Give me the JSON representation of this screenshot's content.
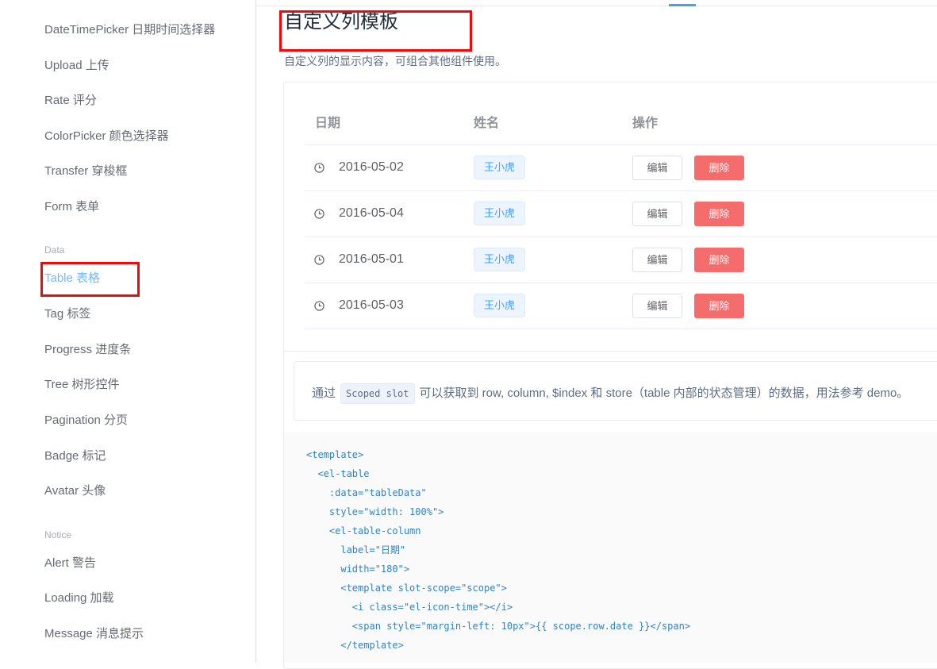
{
  "sidebar": {
    "items_top": [
      {
        "label": "DateTimePicker 日期时间选择器"
      },
      {
        "label": "Upload 上传"
      },
      {
        "label": "Rate 评分"
      },
      {
        "label": "ColorPicker 颜色选择器"
      },
      {
        "label": "Transfer 穿梭框"
      },
      {
        "label": "Form 表单"
      }
    ],
    "group_data": "Data",
    "items_data": [
      {
        "label": "Table 表格"
      },
      {
        "label": "Tag 标签"
      },
      {
        "label": "Progress 进度条"
      },
      {
        "label": "Tree 树形控件"
      },
      {
        "label": "Pagination 分页"
      },
      {
        "label": "Badge 标记"
      },
      {
        "label": "Avatar 头像"
      }
    ],
    "group_notice": "Notice",
    "items_notice": [
      {
        "label": "Alert 警告"
      },
      {
        "label": "Loading 加载"
      },
      {
        "label": "Message 消息提示"
      }
    ]
  },
  "main": {
    "title": "自定义列模板",
    "description": "自定义列的显示内容，可组合其他组件使用。",
    "table": {
      "headers": [
        "日期",
        "姓名",
        "操作"
      ],
      "rows": [
        {
          "date": "2016-05-02",
          "name": "王小虎"
        },
        {
          "date": "2016-05-04",
          "name": "王小虎"
        },
        {
          "date": "2016-05-01",
          "name": "王小虎"
        },
        {
          "date": "2016-05-03",
          "name": "王小虎"
        }
      ],
      "edit_label": "编辑",
      "delete_label": "删除"
    },
    "tip": {
      "prefix": "通过",
      "code": "Scoped slot",
      "suffix": "可以获取到 row, column, $index 和 store（table 内部的状态管理）的数据，用法参考 demo。"
    },
    "code_lines": [
      "<template>",
      "  <el-table",
      "    :data=\"tableData\"",
      "    style=\"width: 100%\">",
      "    <el-table-column",
      "      label=\"日期\"",
      "      width=\"180\">",
      "      <template slot-scope=\"scope\">",
      "        <i class=\"el-icon-time\"></i>",
      "        <span style=\"margin-left: 10px\">{{ scope.row.date }}</span>",
      "      </template>"
    ]
  },
  "colors": {
    "accent": "#409eff",
    "active_nav": "#7cb8f5",
    "danger": "#f56c6c",
    "highlight_box": "#ee0a0a"
  }
}
